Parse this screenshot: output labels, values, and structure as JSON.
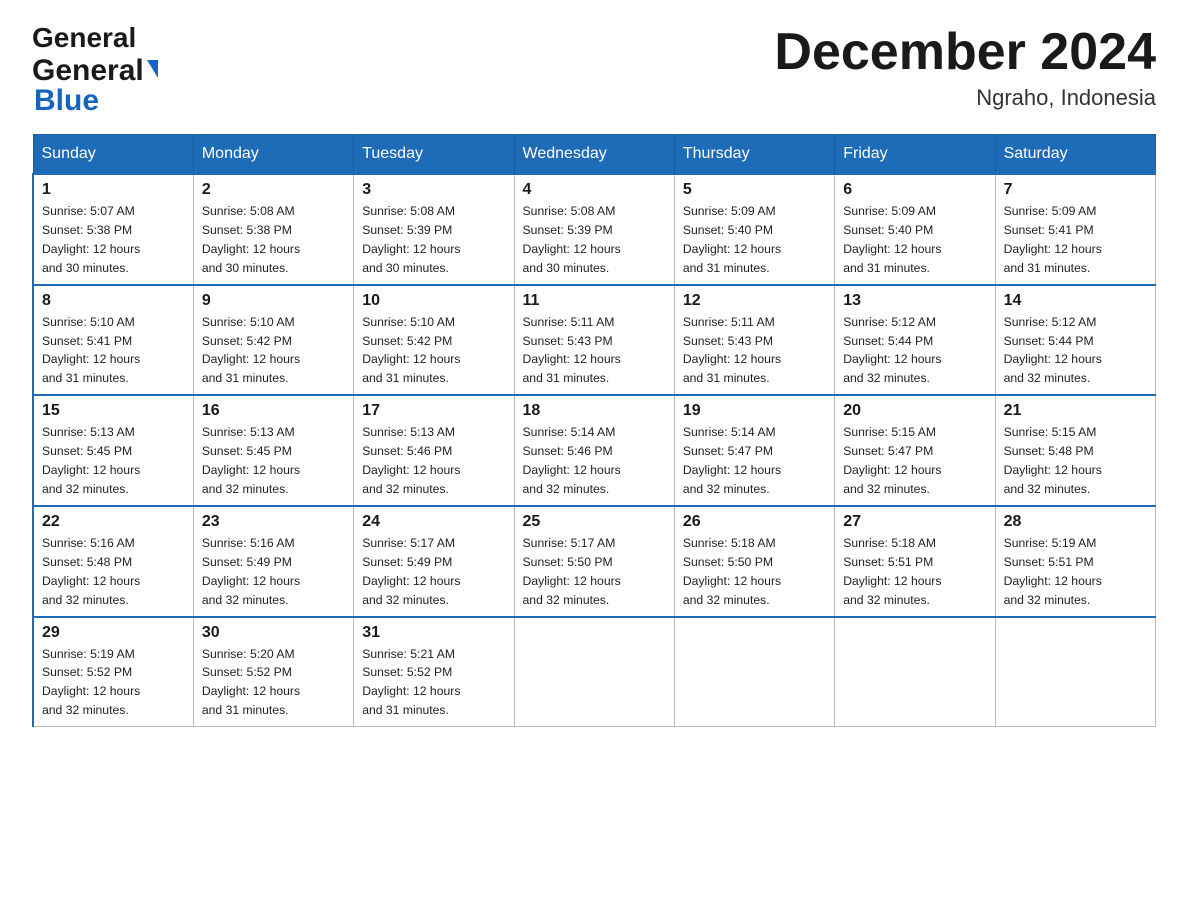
{
  "header": {
    "logo_general": "General",
    "logo_blue": "Blue",
    "title": "December 2024",
    "subtitle": "Ngraho, Indonesia"
  },
  "days_of_week": [
    "Sunday",
    "Monday",
    "Tuesday",
    "Wednesday",
    "Thursday",
    "Friday",
    "Saturday"
  ],
  "weeks": [
    [
      {
        "day": "1",
        "sunrise": "5:07 AM",
        "sunset": "5:38 PM",
        "daylight": "12 hours and 30 minutes."
      },
      {
        "day": "2",
        "sunrise": "5:08 AM",
        "sunset": "5:38 PM",
        "daylight": "12 hours and 30 minutes."
      },
      {
        "day": "3",
        "sunrise": "5:08 AM",
        "sunset": "5:39 PM",
        "daylight": "12 hours and 30 minutes."
      },
      {
        "day": "4",
        "sunrise": "5:08 AM",
        "sunset": "5:39 PM",
        "daylight": "12 hours and 30 minutes."
      },
      {
        "day": "5",
        "sunrise": "5:09 AM",
        "sunset": "5:40 PM",
        "daylight": "12 hours and 31 minutes."
      },
      {
        "day": "6",
        "sunrise": "5:09 AM",
        "sunset": "5:40 PM",
        "daylight": "12 hours and 31 minutes."
      },
      {
        "day": "7",
        "sunrise": "5:09 AM",
        "sunset": "5:41 PM",
        "daylight": "12 hours and 31 minutes."
      }
    ],
    [
      {
        "day": "8",
        "sunrise": "5:10 AM",
        "sunset": "5:41 PM",
        "daylight": "12 hours and 31 minutes."
      },
      {
        "day": "9",
        "sunrise": "5:10 AM",
        "sunset": "5:42 PM",
        "daylight": "12 hours and 31 minutes."
      },
      {
        "day": "10",
        "sunrise": "5:10 AM",
        "sunset": "5:42 PM",
        "daylight": "12 hours and 31 minutes."
      },
      {
        "day": "11",
        "sunrise": "5:11 AM",
        "sunset": "5:43 PM",
        "daylight": "12 hours and 31 minutes."
      },
      {
        "day": "12",
        "sunrise": "5:11 AM",
        "sunset": "5:43 PM",
        "daylight": "12 hours and 31 minutes."
      },
      {
        "day": "13",
        "sunrise": "5:12 AM",
        "sunset": "5:44 PM",
        "daylight": "12 hours and 32 minutes."
      },
      {
        "day": "14",
        "sunrise": "5:12 AM",
        "sunset": "5:44 PM",
        "daylight": "12 hours and 32 minutes."
      }
    ],
    [
      {
        "day": "15",
        "sunrise": "5:13 AM",
        "sunset": "5:45 PM",
        "daylight": "12 hours and 32 minutes."
      },
      {
        "day": "16",
        "sunrise": "5:13 AM",
        "sunset": "5:45 PM",
        "daylight": "12 hours and 32 minutes."
      },
      {
        "day": "17",
        "sunrise": "5:13 AM",
        "sunset": "5:46 PM",
        "daylight": "12 hours and 32 minutes."
      },
      {
        "day": "18",
        "sunrise": "5:14 AM",
        "sunset": "5:46 PM",
        "daylight": "12 hours and 32 minutes."
      },
      {
        "day": "19",
        "sunrise": "5:14 AM",
        "sunset": "5:47 PM",
        "daylight": "12 hours and 32 minutes."
      },
      {
        "day": "20",
        "sunrise": "5:15 AM",
        "sunset": "5:47 PM",
        "daylight": "12 hours and 32 minutes."
      },
      {
        "day": "21",
        "sunrise": "5:15 AM",
        "sunset": "5:48 PM",
        "daylight": "12 hours and 32 minutes."
      }
    ],
    [
      {
        "day": "22",
        "sunrise": "5:16 AM",
        "sunset": "5:48 PM",
        "daylight": "12 hours and 32 minutes."
      },
      {
        "day": "23",
        "sunrise": "5:16 AM",
        "sunset": "5:49 PM",
        "daylight": "12 hours and 32 minutes."
      },
      {
        "day": "24",
        "sunrise": "5:17 AM",
        "sunset": "5:49 PM",
        "daylight": "12 hours and 32 minutes."
      },
      {
        "day": "25",
        "sunrise": "5:17 AM",
        "sunset": "5:50 PM",
        "daylight": "12 hours and 32 minutes."
      },
      {
        "day": "26",
        "sunrise": "5:18 AM",
        "sunset": "5:50 PM",
        "daylight": "12 hours and 32 minutes."
      },
      {
        "day": "27",
        "sunrise": "5:18 AM",
        "sunset": "5:51 PM",
        "daylight": "12 hours and 32 minutes."
      },
      {
        "day": "28",
        "sunrise": "5:19 AM",
        "sunset": "5:51 PM",
        "daylight": "12 hours and 32 minutes."
      }
    ],
    [
      {
        "day": "29",
        "sunrise": "5:19 AM",
        "sunset": "5:52 PM",
        "daylight": "12 hours and 32 minutes."
      },
      {
        "day": "30",
        "sunrise": "5:20 AM",
        "sunset": "5:52 PM",
        "daylight": "12 hours and 31 minutes."
      },
      {
        "day": "31",
        "sunrise": "5:21 AM",
        "sunset": "5:52 PM",
        "daylight": "12 hours and 31 minutes."
      },
      null,
      null,
      null,
      null
    ]
  ]
}
